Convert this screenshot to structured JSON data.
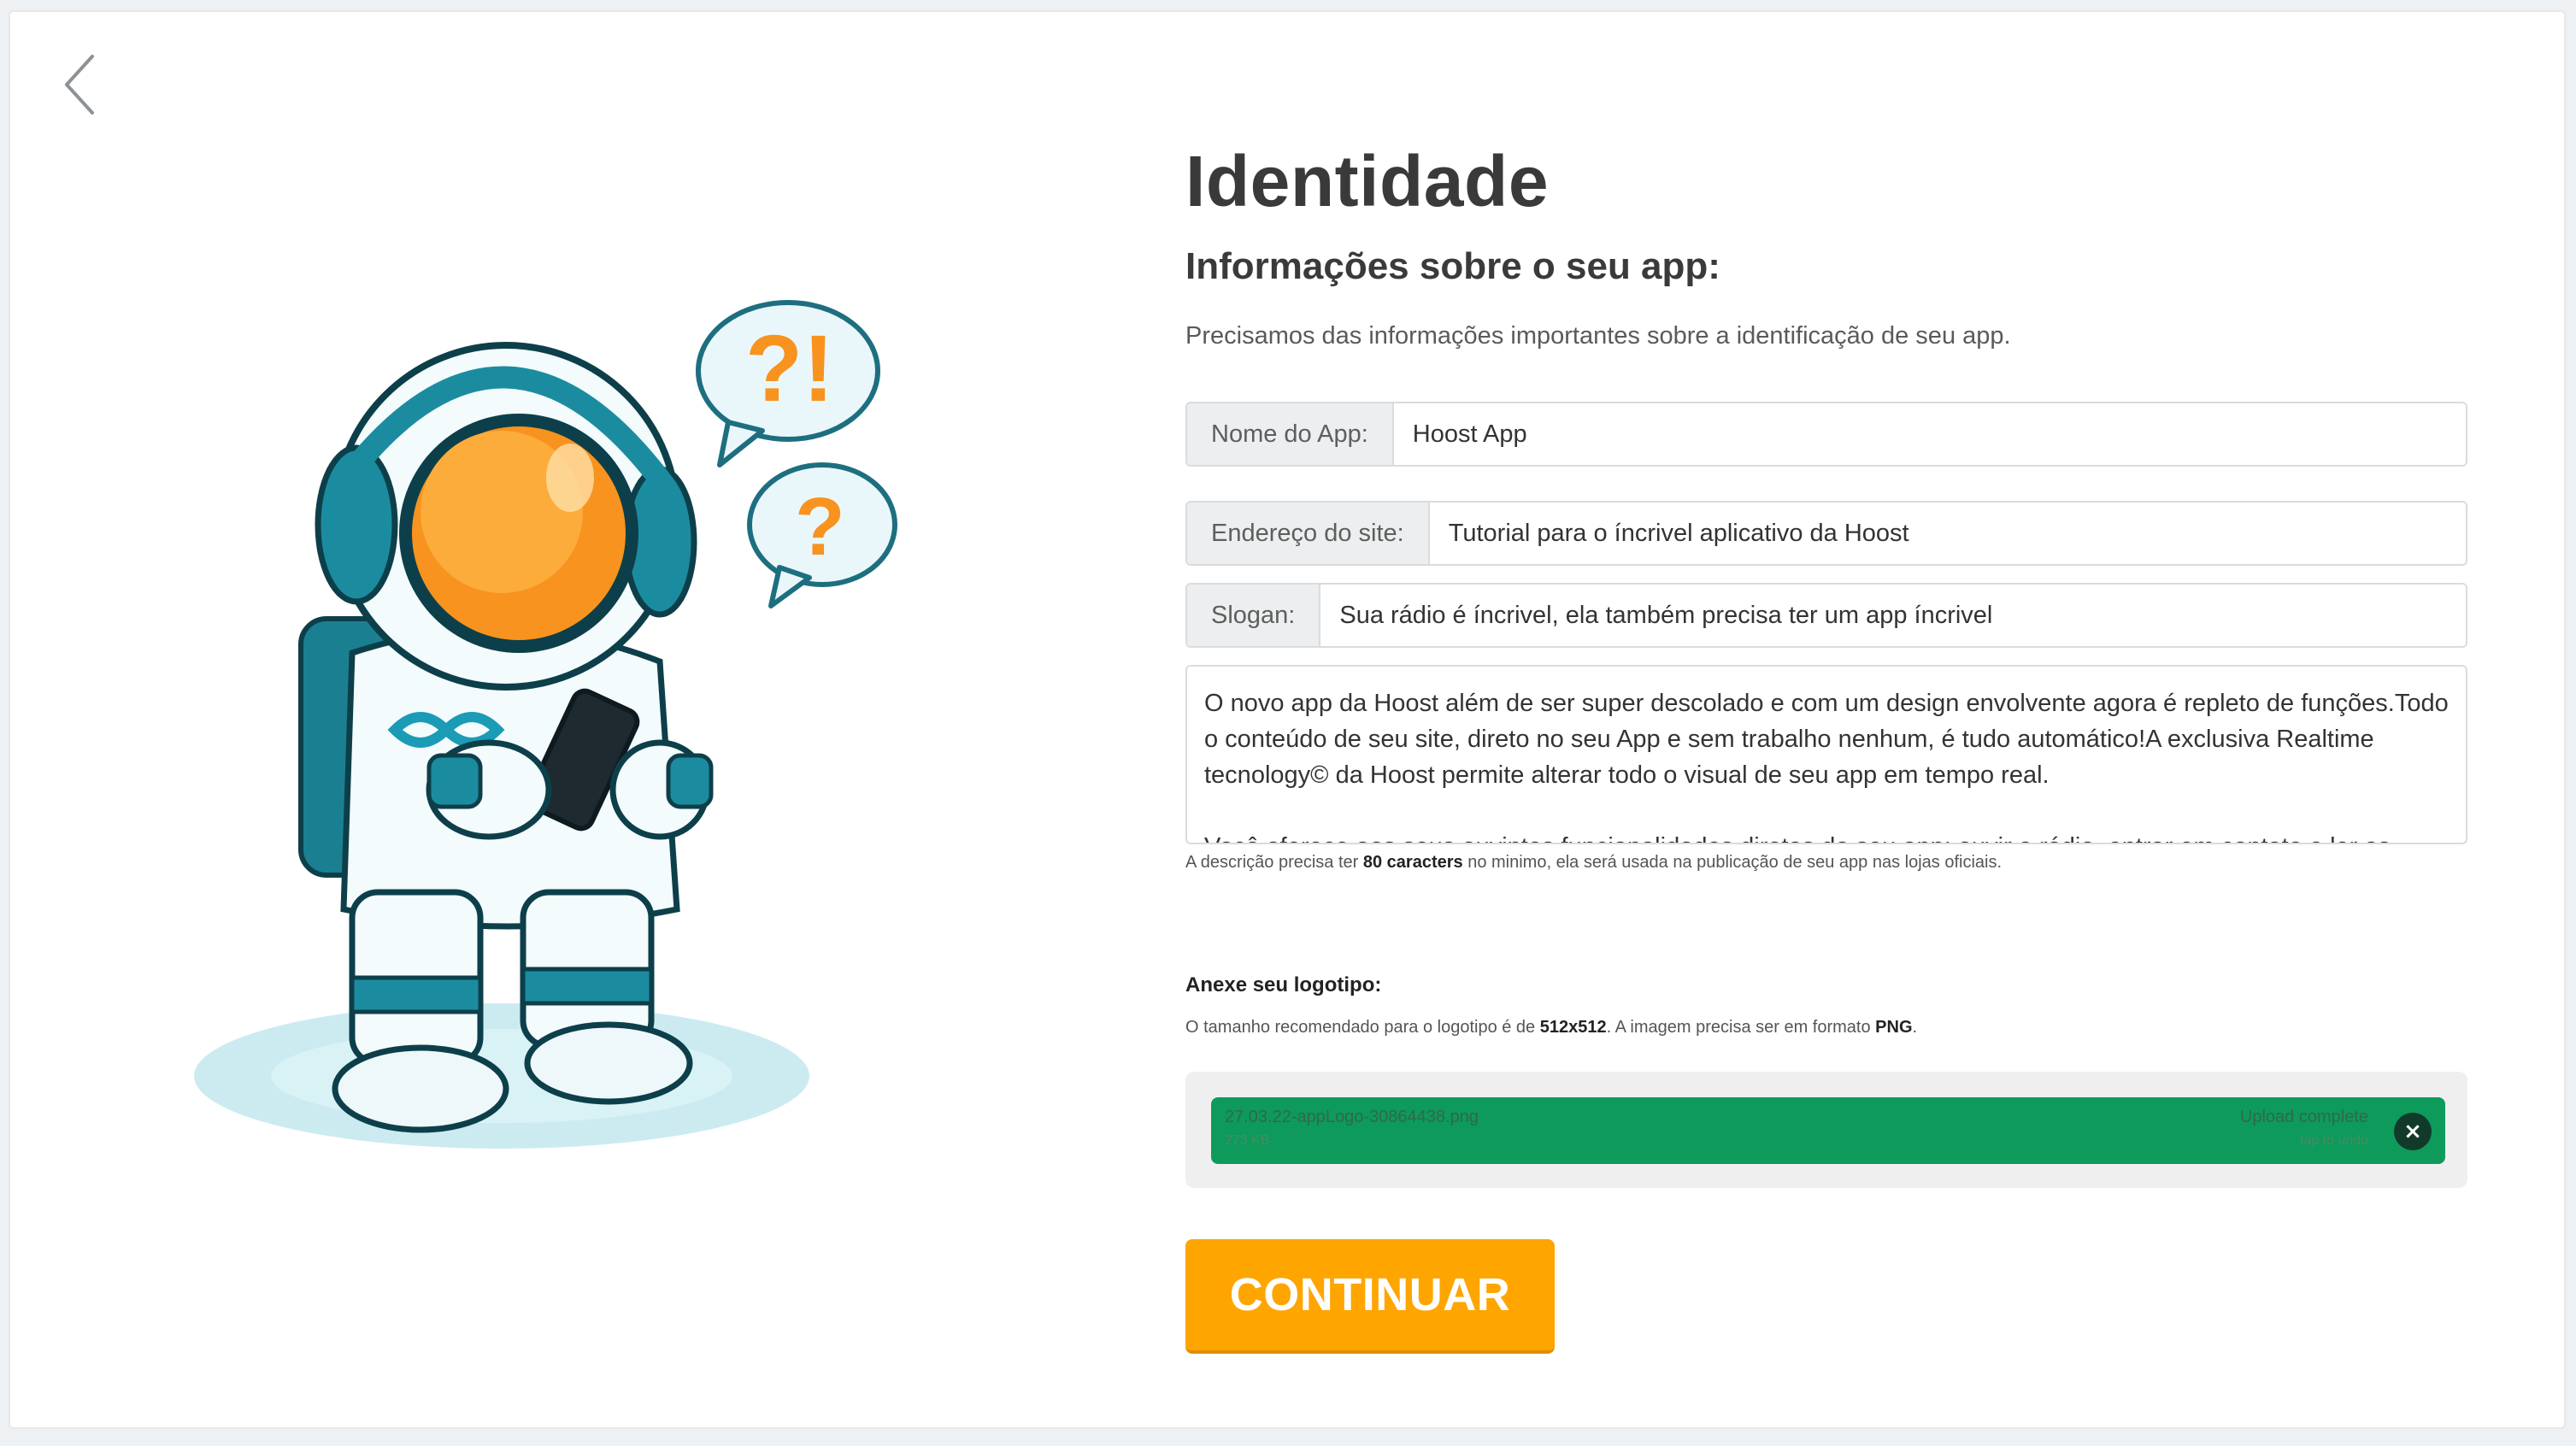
{
  "page": {
    "title": "Identidade",
    "subtitle": "Informações sobre o seu app:",
    "intro": "Precisamos das informações importantes sobre a identificação de seu app."
  },
  "form": {
    "app_name": {
      "label": "Nome do App:",
      "value": "Hoost App"
    },
    "site": {
      "label": "Endereço do site:",
      "value": "Tutorial para o íncrivel aplicativo da Hoost"
    },
    "slogan": {
      "label": "Slogan:",
      "value": "Sua rádio é íncrivel, ela também precisa ter um app íncrivel"
    },
    "description": {
      "paragraph_1": "O novo app da Hoost além de ser super descolado e com um design envolvente agora é repleto de funções.Todo o conteúdo de seu site, direto no seu App e sem trabalho nenhum, é tudo automático!A exclusiva Realtime tecnology© da Hoost permite alterar todo o visual de seu app em tempo real.",
      "paragraph_2": "Você oferece aos seus ouvintes funcionalidades diretas do seu app: ouvir a rádio, entrar em contato e ler as notícias de última hora"
    },
    "description_hint": {
      "before": "A descrição precisa ter ",
      "bold": "80 caracters",
      "after": " no minimo, ela será usada na publicação de seu app nas lojas oficiais."
    }
  },
  "logo": {
    "title": "Anexe seu logotipo:",
    "hint_before": "O tamanho recomendado para o logotipo é de ",
    "hint_size": "512x512",
    "hint_middle": ". A imagem precisa ser em formato ",
    "hint_format": "PNG",
    "hint_after": ".",
    "upload": {
      "filename": "27.03.22-appLogo-30864438.png",
      "size": "273 KB",
      "status": "Upload complete",
      "sub_status": "tap to undo",
      "remove_symbol": "×"
    }
  },
  "actions": {
    "continue_label": "CONTINUAR"
  },
  "icons": {
    "back": "chevron-left-icon",
    "illustration": "astronaut-illustration"
  },
  "colors": {
    "accent": "#ffa500",
    "upload_success": "#0e9a5b",
    "visor": "#f7931e",
    "suit_teal": "#1b8ca0"
  }
}
